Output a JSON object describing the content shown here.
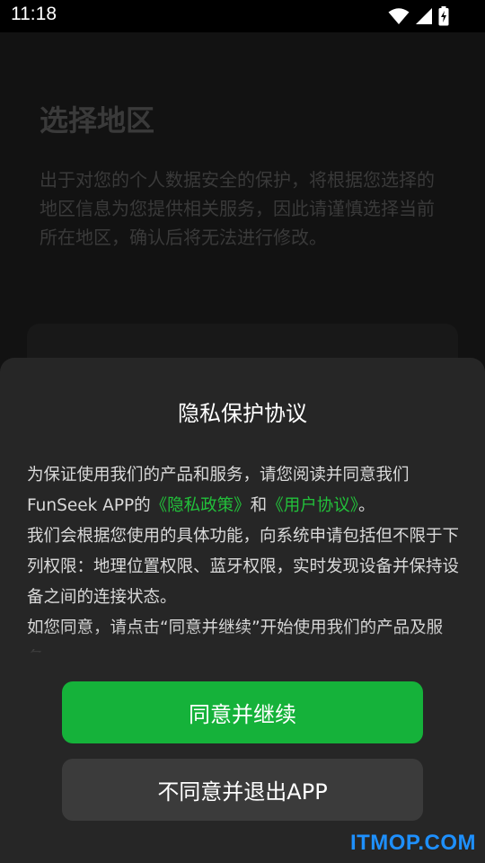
{
  "status_bar": {
    "time": "11:18",
    "icons": [
      "wifi-icon",
      "cellular-signal-icon",
      "battery-charging-icon"
    ]
  },
  "background_page": {
    "title": "选择地区",
    "description": "出于对您的个人数据安全的保护，将根据您选择的地区信息为您提供相关服务，因此请谨慎选择当前所在地区，确认后将无法进行修改。"
  },
  "dialog": {
    "title": "隐私保护协议",
    "para1_before": "为保证使用我们的产品和服务，请您阅读并同意我们FunSeek APP的",
    "privacy_policy_link": "《隐私政策》",
    "para1_middle": "和",
    "user_agreement_link": "《用户协议》",
    "para1_after": "。",
    "para2": "我们会根据您使用的具体功能，向系统申请包括但不限于下列权限：地理位置权限、蓝牙权限，实时发现设备并保持设备之间的连接状态。",
    "para3": "如您同意，请点击“同意并继续”开始使用我们的产品及服务。",
    "agree_button": "同意并继续",
    "decline_button": "不同意并退出APP"
  },
  "watermark": "ITMOP.COM",
  "colors": {
    "accent_green": "#15b23a",
    "link_green": "#22c03a",
    "sheet_bg": "#262626",
    "decline_bg": "#3b3b3b"
  }
}
